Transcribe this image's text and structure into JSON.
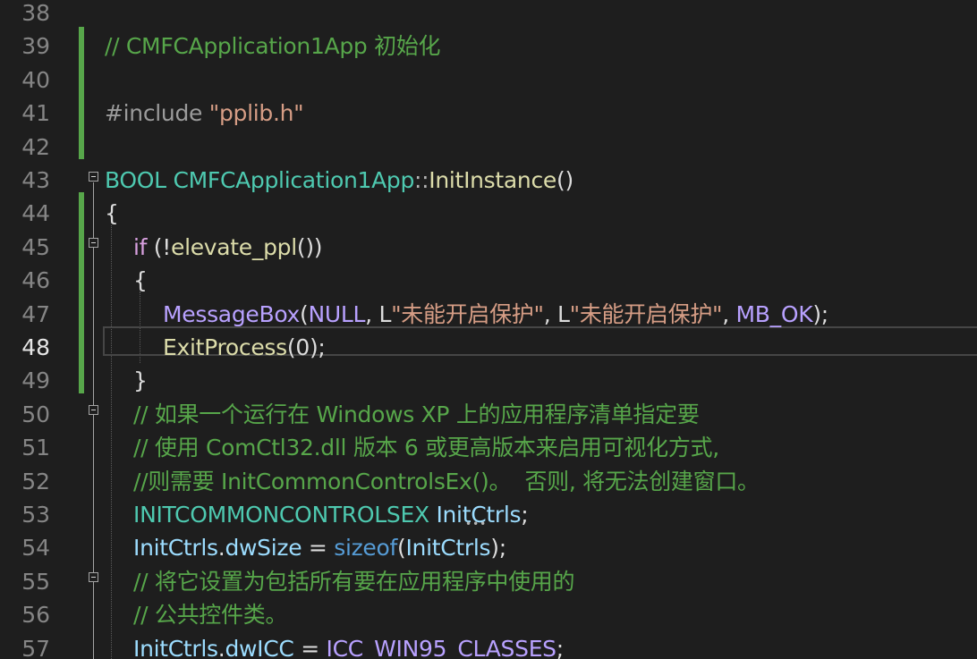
{
  "editor": {
    "current_line": "48",
    "lines": [
      {
        "num": "38",
        "tokens": []
      },
      {
        "num": "39",
        "tokens": [
          {
            "t": "// CMFCApplication1App 初始化",
            "c": "comment"
          }
        ]
      },
      {
        "num": "40",
        "tokens": []
      },
      {
        "num": "41",
        "tokens": [
          {
            "t": "#include ",
            "c": "pre"
          },
          {
            "t": "\"pplib.h\"",
            "c": "str"
          }
        ]
      },
      {
        "num": "42",
        "tokens": []
      },
      {
        "num": "43",
        "tokens": [
          {
            "t": "BOOL ",
            "c": "type"
          },
          {
            "t": "CMFCApplication1App",
            "c": "type"
          },
          {
            "t": "::",
            "c": "punct"
          },
          {
            "t": "InitInstance",
            "c": "func"
          },
          {
            "t": "()",
            "c": "plain"
          }
        ]
      },
      {
        "num": "44",
        "tokens": [
          {
            "t": "{",
            "c": "plain"
          }
        ]
      },
      {
        "num": "45",
        "tokens": [
          {
            "t": "if ",
            "c": "ctrl"
          },
          {
            "t": "(!",
            "c": "plain"
          },
          {
            "t": "elevate_ppl",
            "c": "func"
          },
          {
            "t": "())",
            "c": "plain"
          }
        ]
      },
      {
        "num": "46",
        "tokens": [
          {
            "t": "{",
            "c": "plain"
          }
        ]
      },
      {
        "num": "47",
        "tokens": [
          {
            "t": "MessageBox",
            "c": "mfunc"
          },
          {
            "t": "(",
            "c": "plain"
          },
          {
            "t": "NULL",
            "c": "mfunc"
          },
          {
            "t": ", L",
            "c": "plain"
          },
          {
            "t": "\"未能开启保护\"",
            "c": "str"
          },
          {
            "t": ", L",
            "c": "plain"
          },
          {
            "t": "\"未能开启保护\"",
            "c": "str"
          },
          {
            "t": ", ",
            "c": "plain"
          },
          {
            "t": "MB_OK",
            "c": "mfunc"
          },
          {
            "t": ");",
            "c": "plain"
          }
        ]
      },
      {
        "num": "48",
        "tokens": [
          {
            "t": "ExitProcess",
            "c": "func"
          },
          {
            "t": "(0);",
            "c": "plain"
          }
        ]
      },
      {
        "num": "49",
        "tokens": [
          {
            "t": "}",
            "c": "plain"
          }
        ]
      },
      {
        "num": "50",
        "tokens": [
          {
            "t": "// 如果一个运行在 Windows XP 上的应用程序清单指定要",
            "c": "comment"
          }
        ]
      },
      {
        "num": "51",
        "tokens": [
          {
            "t": "// 使用 ComCtl32.dll 版本 6 或更高版本来启用可视化方式,",
            "c": "comment"
          }
        ]
      },
      {
        "num": "52",
        "tokens": [
          {
            "t": "//则需要 InitCommonControlsEx()。  否则, 将无法创建窗口。",
            "c": "comment"
          }
        ]
      },
      {
        "num": "53",
        "tokens": [
          {
            "t": "INITCOMMONCONTROLSEX ",
            "c": "type"
          },
          {
            "t": "InitCtrls",
            "c": "var"
          },
          {
            "t": ";",
            "c": "plain"
          }
        ]
      },
      {
        "num": "54",
        "tokens": [
          {
            "t": "InitCtrls",
            "c": "var"
          },
          {
            "t": ".",
            "c": "plain"
          },
          {
            "t": "dwSize",
            "c": "var"
          },
          {
            "t": " = ",
            "c": "plain"
          },
          {
            "t": "sizeof",
            "c": "kw"
          },
          {
            "t": "(",
            "c": "plain"
          },
          {
            "t": "InitCtrls",
            "c": "var"
          },
          {
            "t": ");",
            "c": "plain"
          }
        ]
      },
      {
        "num": "55",
        "tokens": [
          {
            "t": "// 将它设置为包括所有要在应用程序中使用的",
            "c": "comment"
          }
        ]
      },
      {
        "num": "56",
        "tokens": [
          {
            "t": "// 公共控件类。",
            "c": "comment"
          }
        ]
      },
      {
        "num": "57",
        "tokens": [
          {
            "t": "InitCtrls",
            "c": "var"
          },
          {
            "t": ".",
            "c": "plain"
          },
          {
            "t": "dwICC",
            "c": "var"
          },
          {
            "t": " = ",
            "c": "plain"
          },
          {
            "t": "ICC_WIN95_CLASSES",
            "c": "mfunc"
          },
          {
            "t": ";",
            "c": "plain"
          }
        ]
      }
    ]
  },
  "icons": {
    "fold": "collapse-minus-icon"
  },
  "colors": {
    "background": "#1e1e1e",
    "comment": "#57a64a",
    "string": "#d69d85",
    "type": "#4ec9b0",
    "function": "#dcdcaa",
    "control": "#d8a0df",
    "macro": "#b8a1ff",
    "variable": "#9cdcfe",
    "change_bar": "#57a64a"
  }
}
